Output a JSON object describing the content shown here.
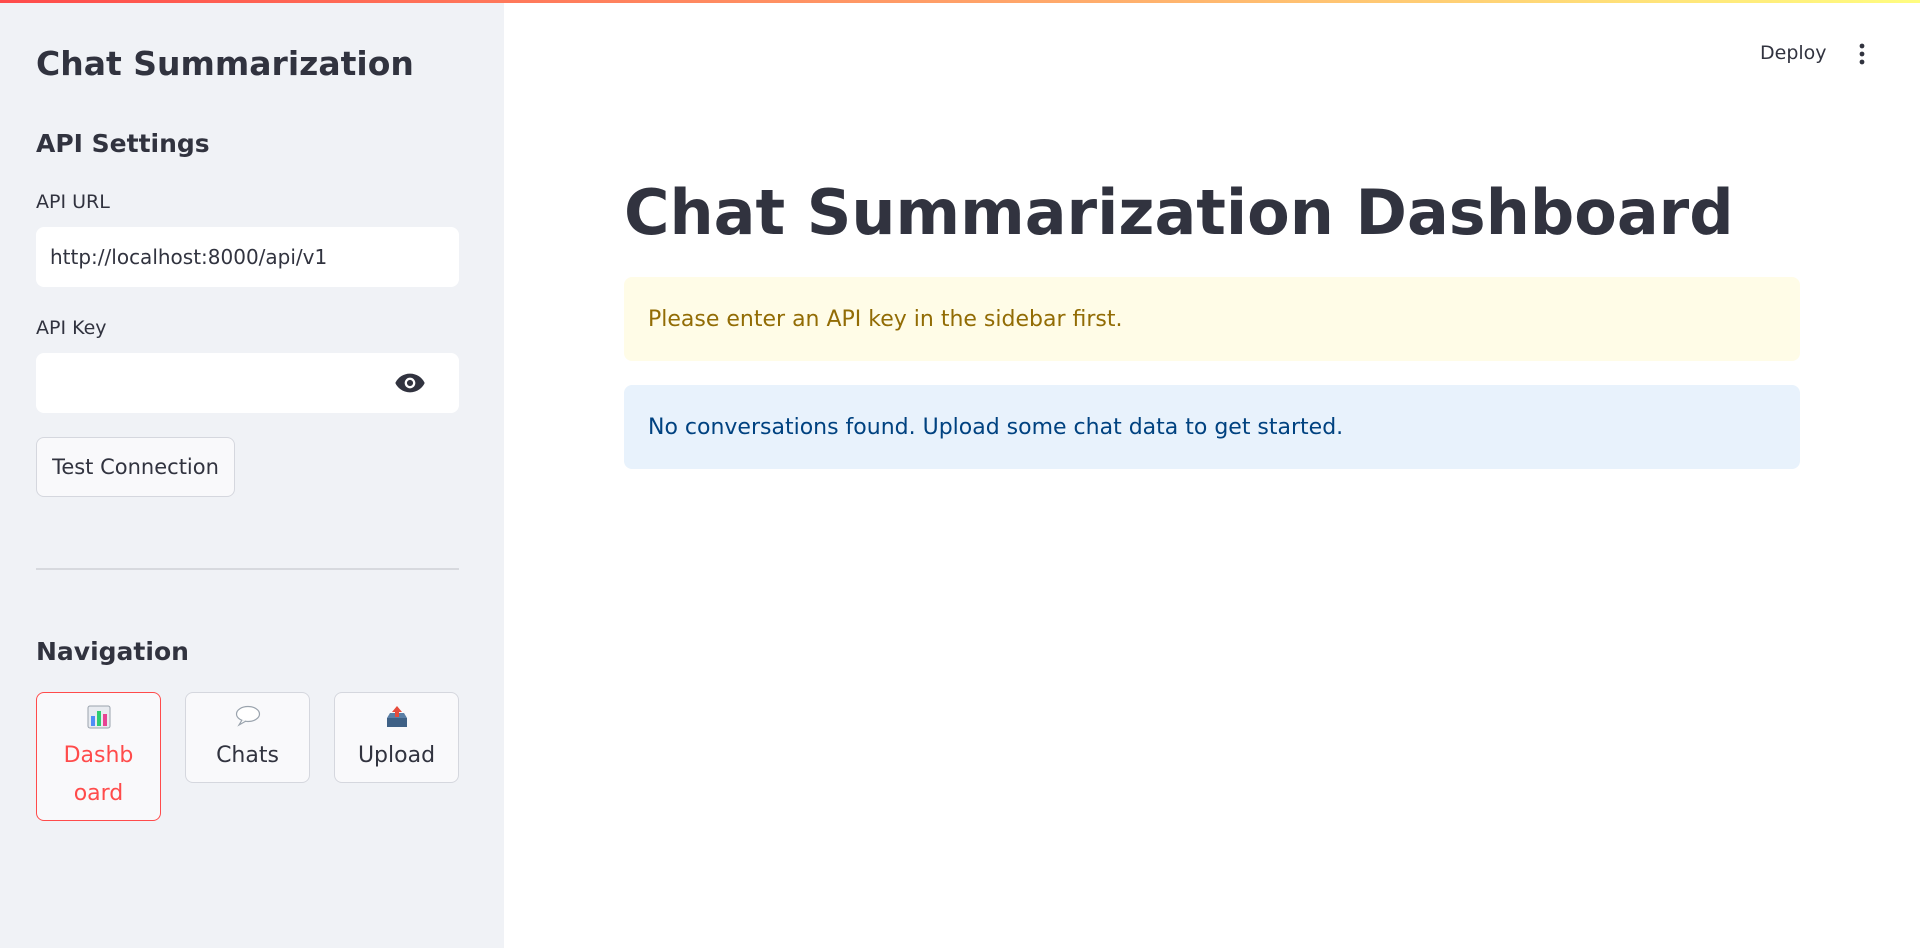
{
  "sidebar": {
    "title": "Chat Summarization",
    "api_settings": {
      "heading": "API Settings",
      "api_url_label": "API URL",
      "api_url_value": "http://localhost:8000/api/v1",
      "api_key_label": "API Key",
      "api_key_value": "",
      "test_button": "Test Connection"
    },
    "navigation": {
      "heading": "Navigation",
      "items": [
        {
          "icon": "bar-chart-icon",
          "label": "Dashboard",
          "active": true
        },
        {
          "icon": "speech-bubble-icon",
          "label": "Chats",
          "active": false
        },
        {
          "icon": "outbox-upload-icon",
          "label": "Upload",
          "active": false
        }
      ]
    }
  },
  "header": {
    "deploy_label": "Deploy"
  },
  "main": {
    "title": "Chat Summarization Dashboard",
    "warning_message": "Please enter an API key in the sidebar first.",
    "info_message": "No conversations found. Upload some chat data to get started."
  },
  "colors": {
    "accent": "#ff4b4b",
    "sidebar_bg": "#f0f2f6",
    "warning_bg": "#fffce7",
    "warning_text": "#926c05",
    "info_bg": "#e8f2fc",
    "info_text": "#004280"
  }
}
